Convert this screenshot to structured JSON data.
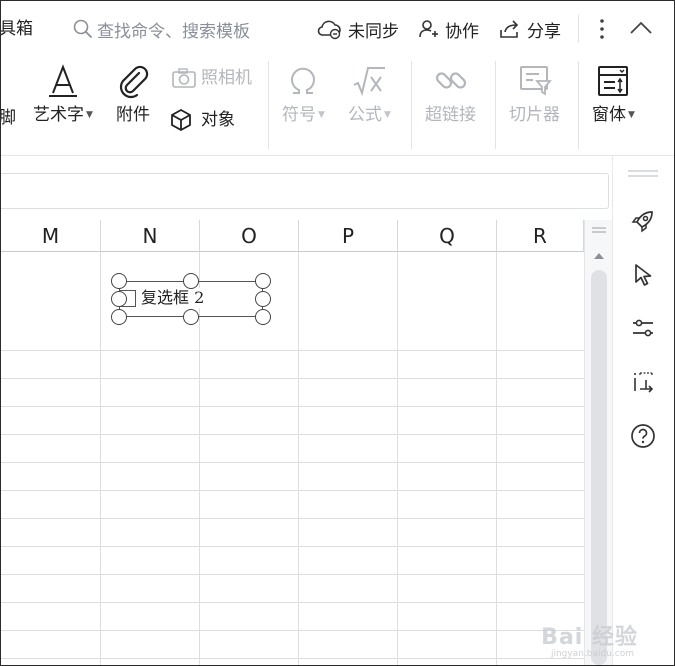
{
  "topbar": {
    "partial_title": "具箱",
    "search_text": "查找命令、搜索模板",
    "sync_label": "未同步",
    "collab_label": "协作",
    "share_label": "分享"
  },
  "ribbon": {
    "partial_label": "脚",
    "art_text": "艺术字",
    "attachment": "附件",
    "camera": "照相机",
    "object": "对象",
    "symbol": "符号",
    "formula": "公式",
    "hyperlink": "超链接",
    "slicer": "切片器",
    "window": "窗体"
  },
  "grid": {
    "columns": [
      "M",
      "N",
      "O",
      "P",
      "Q",
      "R"
    ]
  },
  "checkbox_control": {
    "label": "复选框 2"
  },
  "watermark": {
    "text": "Bai 经验",
    "sub": "jingyan.baidu.com"
  },
  "colors": {
    "accent": "#222222",
    "disabled": "#b3b6bc",
    "grid_line": "#dcdee2"
  }
}
